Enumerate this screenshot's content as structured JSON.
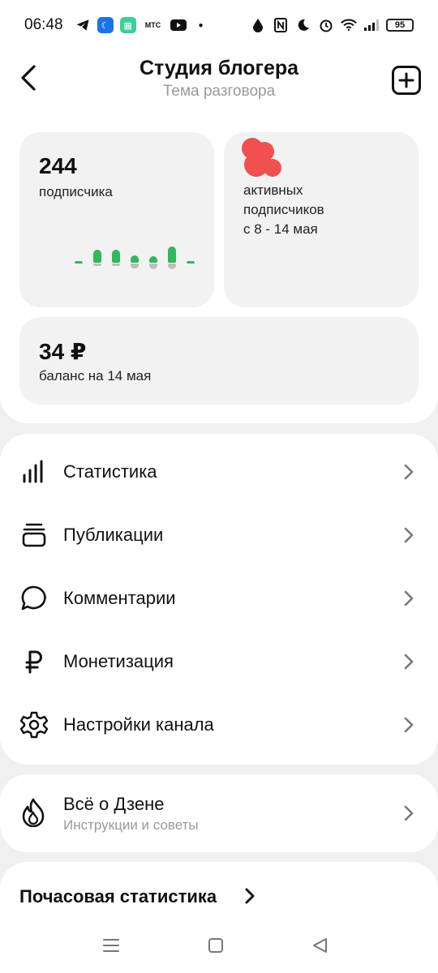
{
  "status_bar": {
    "time": "06:48",
    "battery": "95",
    "mts_label": "МТС"
  },
  "header": {
    "title": "Студия блогера",
    "subtitle": "Тема разговора"
  },
  "stats": {
    "subscribers_value": "244",
    "subscribers_label": "подписчика",
    "active_label": "активных\nподписчиков\nс 8 - 14 мая",
    "balance_value": "34 ₽",
    "balance_label": "баланс на 14 мая",
    "accent_color": "#30b85a",
    "redaction_color": "#f05050"
  },
  "menu": {
    "items": [
      {
        "label": "Статистика",
        "icon": "bar-chart-icon"
      },
      {
        "label": "Публикации",
        "icon": "stack-icon"
      },
      {
        "label": "Комментарии",
        "icon": "chat-bubble-icon"
      },
      {
        "label": "Монетизация",
        "icon": "ruble-icon"
      },
      {
        "label": "Настройки канала",
        "icon": "gear-icon"
      }
    ]
  },
  "zen": {
    "title": "Всё о Дзене",
    "subtitle": "Инструкции и советы",
    "icon": "flame-icon"
  },
  "hourly": {
    "title": "Почасовая статистика"
  }
}
